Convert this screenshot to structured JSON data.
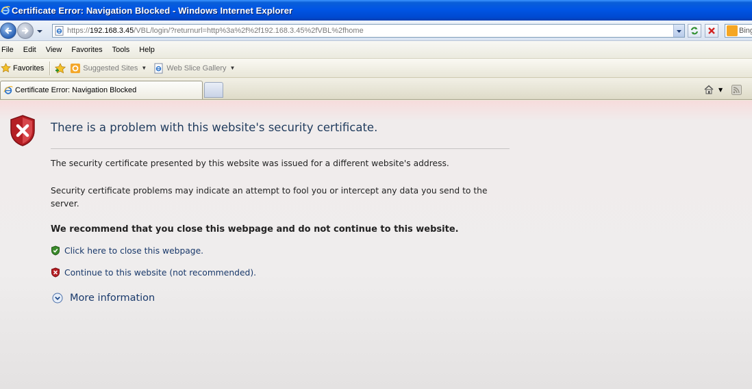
{
  "window": {
    "title": "Certificate Error: Navigation Blocked - Windows Internet Explorer"
  },
  "address_bar": {
    "url_scheme": "https://",
    "url_host": "192.168.3.45",
    "url_path": "/VBL/login/?returnurl=http%3a%2f%2f192.168.3.45%2fVBL%2fhome"
  },
  "search": {
    "placeholder": "Bing"
  },
  "menu": [
    "File",
    "Edit",
    "View",
    "Favorites",
    "Tools",
    "Help"
  ],
  "favorites_bar": {
    "favorites_label": "Favorites",
    "links": [
      {
        "label": "Suggested Sites",
        "icon": "suggested-sites-icon"
      },
      {
        "label": "Web Slice Gallery",
        "icon": "ie-page-icon"
      }
    ]
  },
  "tab": {
    "label": "Certificate Error: Navigation Blocked"
  },
  "content": {
    "title": "There is a problem with this website's security certificate.",
    "p1": "The security certificate presented by this website was issued for a different website's address.",
    "p2": "Security certificate problems may indicate an attempt to fool you or intercept any data you send to the server.",
    "recommend": "We recommend that you close this webpage and do not continue to this website.",
    "action_close": "Click here to close this webpage.",
    "action_continue": "Continue to this website (not recommended).",
    "more_info": "More information"
  },
  "colors": {
    "title_bar": "#0055e5",
    "link": "#18386a",
    "heading": "#1f3b5d",
    "error_red": "#c0272d",
    "safe_green": "#3a8a2a"
  }
}
